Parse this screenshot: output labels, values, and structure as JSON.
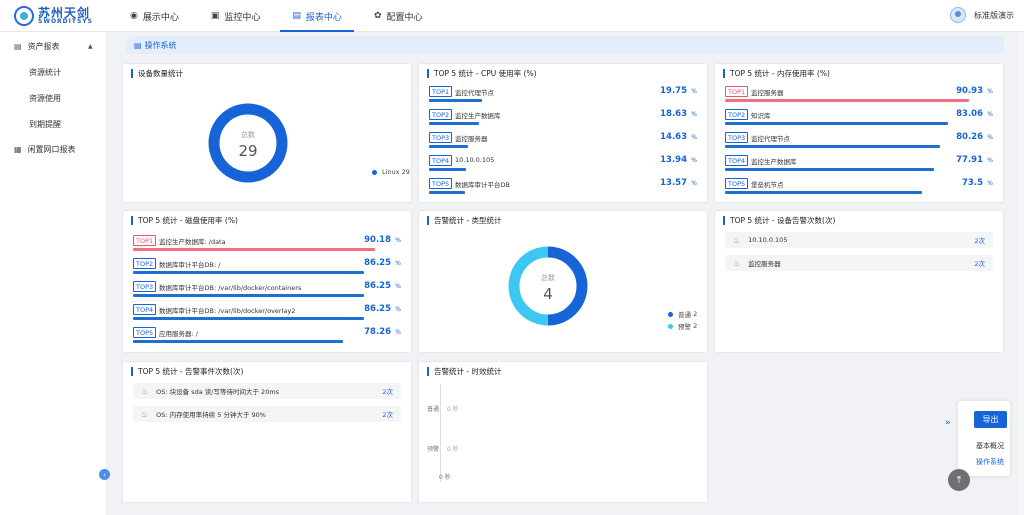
{
  "brand": {
    "cn": "苏州天剑",
    "en": "SWORDITSYS"
  },
  "nav": [
    {
      "label": "展示中心",
      "icon": "monitor-icon",
      "glyph": "◉"
    },
    {
      "label": "监控中心",
      "icon": "monitor-icon",
      "glyph": "▣"
    },
    {
      "label": "报表中心",
      "icon": "report-icon",
      "glyph": "▤"
    },
    {
      "label": "配置中心",
      "icon": "gear-icon",
      "glyph": "✿"
    }
  ],
  "user": {
    "name": "标准版演示"
  },
  "sidebar": {
    "group1": "资产报表",
    "sub": [
      "资源统计",
      "资源使用",
      "到期提醒"
    ],
    "group2": "闲置网口报表"
  },
  "breadcrumb": "操作系统",
  "device": {
    "title": "设备数量统计",
    "center_label": "总数",
    "total": "29",
    "legend": [
      {
        "name": "Linux",
        "value": "29",
        "color": "#1664d8"
      }
    ]
  },
  "cpu": {
    "title": "TOP 5 统计 - CPU 使用率 (%)",
    "items": [
      {
        "rank": "TOP1",
        "name": "监控代理节点",
        "value": "19.75",
        "pct": 19.75
      },
      {
        "rank": "TOP2",
        "name": "监控生产数据库",
        "value": "18.63",
        "pct": 18.63
      },
      {
        "rank": "TOP3",
        "name": "监控服务器",
        "value": "14.63",
        "pct": 14.63
      },
      {
        "rank": "TOP4",
        "name": "10.10.0.105",
        "value": "13.94",
        "pct": 13.94
      },
      {
        "rank": "TOP5",
        "name": "数据库审计平台DB",
        "value": "13.57",
        "pct": 13.57
      }
    ]
  },
  "mem": {
    "title": "TOP 5 统计 - 内存使用率 (%)",
    "items": [
      {
        "rank": "TOP1",
        "name": "监控服务器",
        "value": "90.93",
        "pct": 90.93,
        "red": true
      },
      {
        "rank": "TOP2",
        "name": "知识库",
        "value": "83.06",
        "pct": 83.06
      },
      {
        "rank": "TOP3",
        "name": "监控代理节点",
        "value": "80.26",
        "pct": 80.26
      },
      {
        "rank": "TOP4",
        "name": "监控生产数据库",
        "value": "77.91",
        "pct": 77.91
      },
      {
        "rank": "TOP5",
        "name": "堡垒机节点",
        "value": "73.5",
        "pct": 73.5
      }
    ]
  },
  "disk": {
    "title": "TOP 5 统计 - 磁盘使用率 (%)",
    "items": [
      {
        "rank": "TOP1",
        "name": "监控生产数据库: /data",
        "value": "90.18",
        "pct": 90.18,
        "red": true
      },
      {
        "rank": "TOP2",
        "name": "数据库审计平台DB: /",
        "value": "86.25",
        "pct": 86.25
      },
      {
        "rank": "TOP3",
        "name": "数据库审计平台DB: /var/lib/docker/containers",
        "value": "86.25",
        "pct": 86.25
      },
      {
        "rank": "TOP4",
        "name": "数据库审计平台DB: /var/lib/docker/overlay2",
        "value": "86.25",
        "pct": 86.25
      },
      {
        "rank": "TOP5",
        "name": "应用服务器: /",
        "value": "78.26",
        "pct": 78.26
      }
    ]
  },
  "unit": "%",
  "alarm_type": {
    "title": "告警统计 - 类型统计",
    "center_label": "总数",
    "total": "4",
    "legend": [
      {
        "name": "普通",
        "value": "2",
        "color": "#1664d8"
      },
      {
        "name": "预警",
        "value": "2",
        "color": "#3cc8f2"
      }
    ]
  },
  "device_alarm": {
    "title": "TOP 5 统计 - 设备告警次数(次)",
    "items": [
      {
        "name": "10.10.0.105",
        "count": "2次"
      },
      {
        "name": "监控服务器",
        "count": "2次"
      }
    ]
  },
  "event_alarm": {
    "title": "TOP 5 统计 - 告警事件次数(次)",
    "items": [
      {
        "name": "OS: 块设备 sda 读/写等待时间大于 20ms",
        "count": "2次"
      },
      {
        "name": "OS: 内存使用率持续 5 分钟大于 90%",
        "count": "2次"
      }
    ]
  },
  "timeliness": {
    "title": "告警统计 - 时效统计",
    "rows": [
      {
        "label": "普通",
        "value": "0 秒"
      },
      {
        "label": "预警",
        "value": "0 秒"
      }
    ],
    "axis": "0 秒"
  },
  "float_panel": {
    "export": "导出",
    "items": [
      "基本概况",
      "操作系统"
    ]
  },
  "colors": {
    "accent": "#1664d8",
    "alert": "#e55a6a",
    "cyan": "#3cc8f2"
  }
}
